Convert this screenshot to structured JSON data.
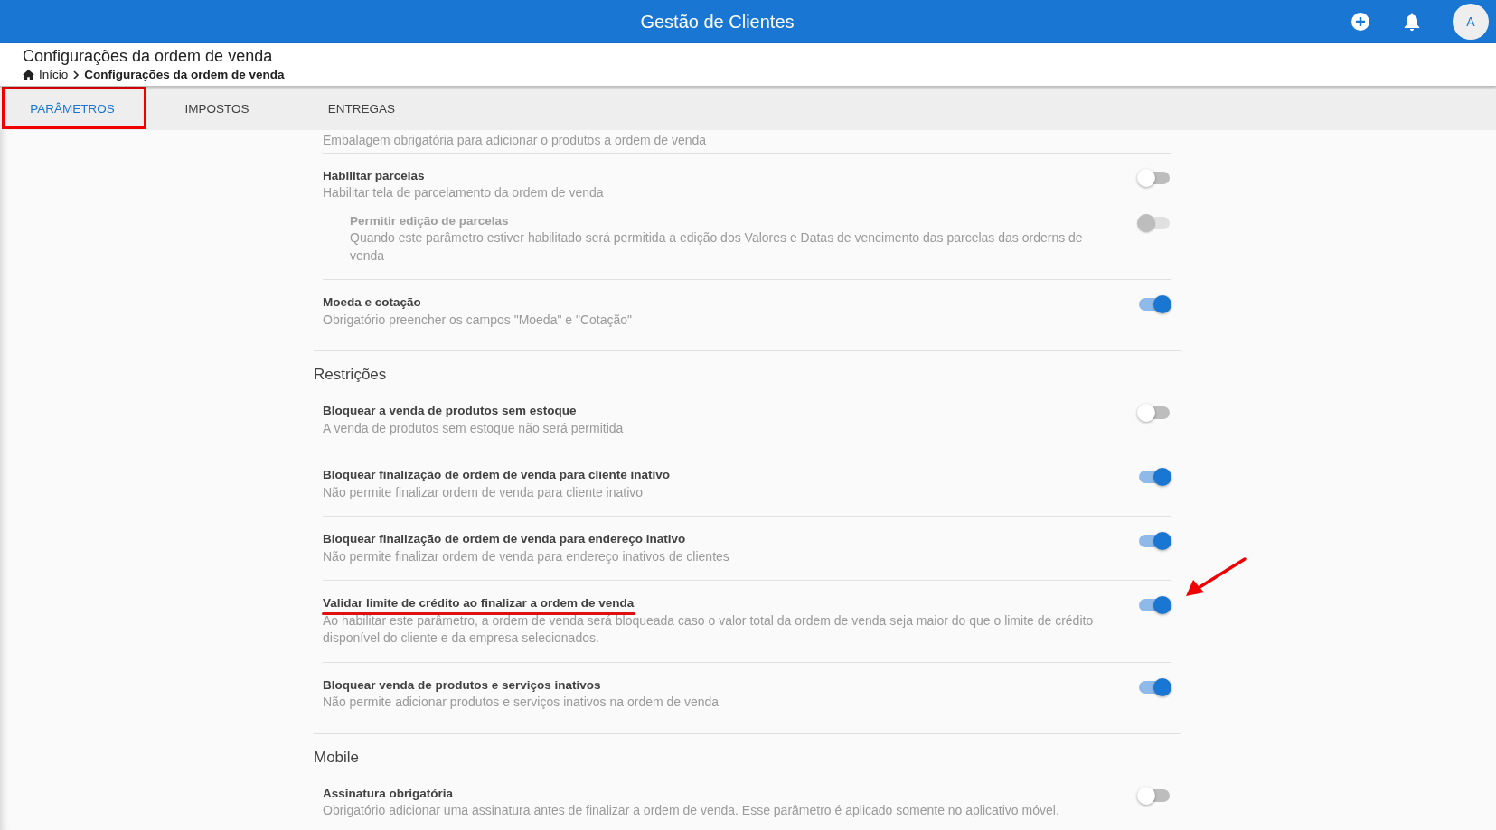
{
  "header": {
    "title": "Gestão de Clientes",
    "avatar": "A"
  },
  "page": {
    "title": "Configurações da ordem de venda",
    "breadcrumb": [
      {
        "label": "Início"
      },
      {
        "label": "Configurações da ordem de venda"
      }
    ]
  },
  "tabs": [
    {
      "label": "PARÂMETROS",
      "selected": true,
      "highlighted": true
    },
    {
      "label": "IMPOSTOS",
      "selected": false,
      "highlighted": false
    },
    {
      "label": "ENTREGAS",
      "selected": false,
      "highlighted": false
    }
  ],
  "sections": [
    {
      "rows": [
        {
          "description": "Embalagem obrigatória para adicionar o produtos a ordem de venda"
        },
        {
          "title": "Habilitar parcelas",
          "description": "Habilitar tela de parcelamento da ordem de venda",
          "on": false,
          "disabled": false,
          "children": [
            {
              "title": "Permitir edição de parcelas",
              "description": "Quando este parâmetro estiver habilitado será permitida a edição dos Valores e Datas de vencimento das parcelas das orderns de venda",
              "on": false,
              "disabled": true
            }
          ]
        },
        {
          "title": "Moeda e cotação",
          "description": "Obrigatório preencher os campos \"Moeda\" e \"Cotação\"",
          "on": true,
          "disabled": false
        }
      ]
    },
    {
      "heading": "Restrições",
      "rows": [
        {
          "title": "Bloquear a venda de produtos sem estoque",
          "description": "A venda de produtos sem estoque não será permitida",
          "on": false,
          "disabled": false
        },
        {
          "title": "Bloquear finalização de ordem de venda para cliente inativo",
          "description": "Não permite finalizar ordem de venda para cliente inativo",
          "on": true,
          "disabled": false
        },
        {
          "title": "Bloquear finalização de ordem de venda para endereço inativo",
          "description": "Não permite finalizar ordem de venda para endereço inativos de clientes",
          "on": true,
          "disabled": false
        },
        {
          "title": "Validar limite de crédito ao finalizar a ordem de venda",
          "description": "Ao habilitar este parâmetro, a ordem de venda será bloqueada caso o valor total da ordem de venda seja maior do que o limite de crédito disponível do cliente e da empresa selecionados.",
          "on": true,
          "disabled": false,
          "underlined": true,
          "arrow": true
        },
        {
          "title": "Bloquear venda de produtos e serviços inativos",
          "description": "Não permite adicionar produtos e serviços inativos na ordem de venda",
          "on": true,
          "disabled": false
        }
      ]
    },
    {
      "heading": "Mobile",
      "rows": [
        {
          "title": "Assinatura obrigatória",
          "description": "Obrigatório adicionar uma assinatura antes de finalizar a ordem de venda. Esse parâmetro é aplicado somente no aplicativo móvel.",
          "on": false,
          "disabled": false
        }
      ]
    }
  ]
}
